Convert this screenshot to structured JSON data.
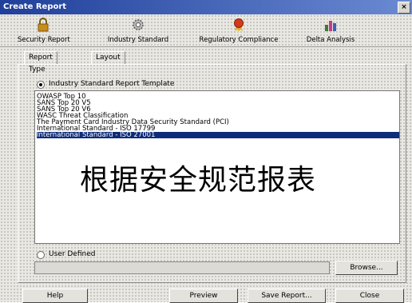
{
  "window": {
    "title": "Create Report",
    "close_glyph": "×"
  },
  "toolbar": {
    "items": [
      {
        "label": "Security Report",
        "icon": "padlock-icon",
        "color": "#c98b1a"
      },
      {
        "label": "Industry Standard",
        "icon": "gear-icon",
        "color": "#8a8a8a"
      },
      {
        "label": "Regulatory Compliance",
        "icon": "award-ribbon-icon",
        "color": "#d23a1b"
      },
      {
        "label": "Delta Analysis",
        "icon": "bar-chart-icon",
        "color": "#3d7a3a"
      }
    ]
  },
  "tabs": [
    {
      "label": "Report Type",
      "active": true
    },
    {
      "label": "Layout",
      "active": false
    }
  ],
  "industry_standard": {
    "radio_label": "Industry Standard Report Template",
    "selected": true,
    "templates": [
      "OWASP Top 10",
      "SANS Top 20 V5",
      "SANS Top 20 V6",
      "WASC Threat Classification",
      "The Payment Card Industry Data Security Standard (PCI)",
      "International Standard - ISO 17799",
      "International Standard - ISO 27001"
    ],
    "selected_index": 6
  },
  "overlay_text": "根据安全规范报表",
  "user_defined": {
    "radio_label": "User Defined",
    "selected": false,
    "path_value": "",
    "browse_label": "Browse..."
  },
  "footer": {
    "help": "Help",
    "preview": "Preview",
    "save": "Save Report...",
    "close": "Close"
  }
}
